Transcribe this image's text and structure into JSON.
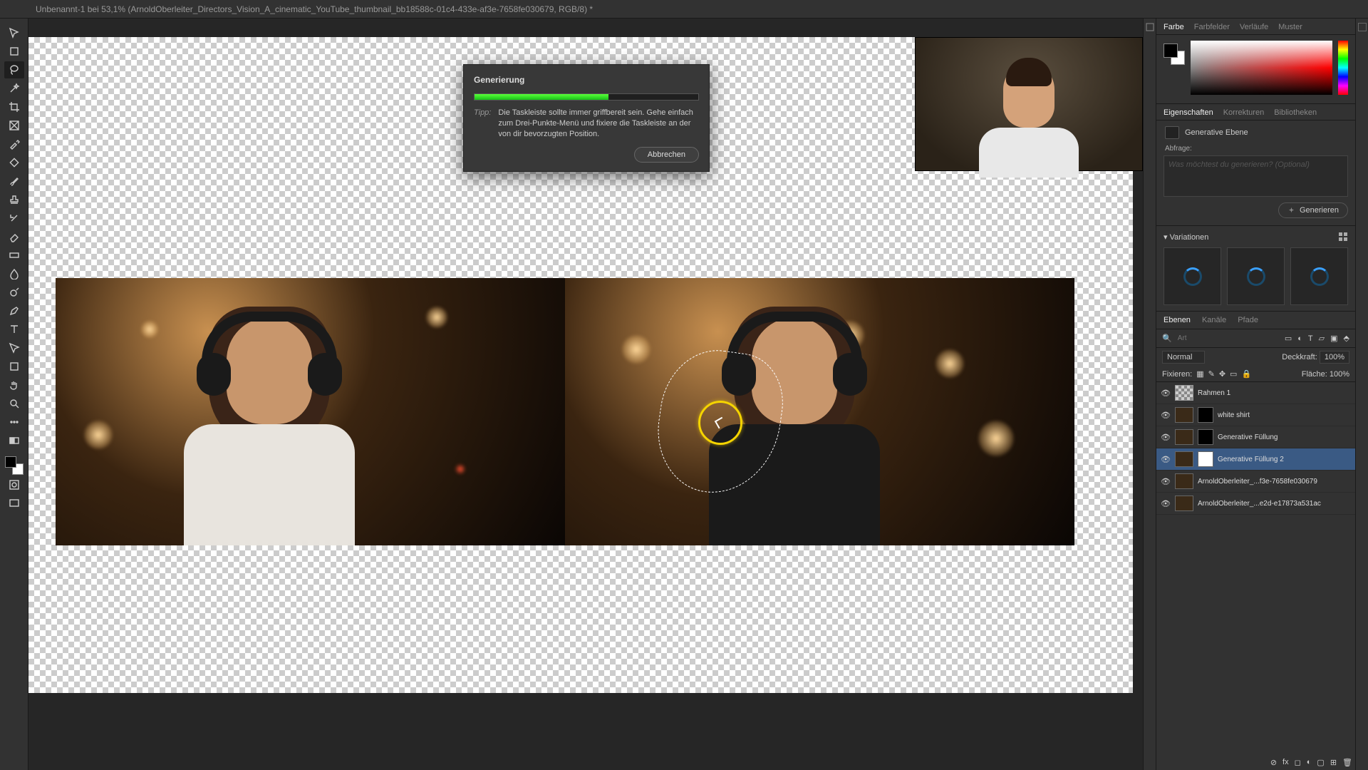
{
  "titlebar": {
    "title": "Unbenannt-1 bei 53,1% (ArnoldOberleiter_Directors_Vision_A_cinematic_YouTube_thumbnail_bb18588c-01c4-433e-af3e-7658fe030679, RGB/8) *"
  },
  "dialog": {
    "title": "Generierung",
    "progress_pct": 60,
    "tip_label": "Tipp:",
    "tip_text": "Die Taskleiste sollte immer griffbereit sein. Gehe einfach zum Drei-Punkte-Menü und fixiere die Taskleiste an der von dir bevorzugten Position.",
    "cancel": "Abbrechen"
  },
  "color_tabs": [
    "Farbe",
    "Farbfelder",
    "Verläufe",
    "Muster"
  ],
  "props_tabs": [
    "Eigenschaften",
    "Korrekturen",
    "Bibliotheken"
  ],
  "props": {
    "layer_type": "Generative Ebene",
    "prompt_label": "Abfrage:",
    "prompt_placeholder": "Was möchtest du generieren? (Optional)",
    "generate": "Generieren"
  },
  "variations": {
    "label": "Variationen"
  },
  "layer_tabs": [
    "Ebenen",
    "Kanäle",
    "Pfade"
  ],
  "layer_opts": {
    "search_placeholder": "Art",
    "blend": "Normal",
    "opacity_label": "Deckkraft:",
    "opacity": "100%",
    "lock_label": "Fixieren:",
    "fill_label": "Fläche:",
    "fill": "100%"
  },
  "layers": [
    {
      "name": "Rahmen 1",
      "frame": true
    },
    {
      "name": "white shirt",
      "mask": "black"
    },
    {
      "name": "Generative Füllung",
      "mask": "black"
    },
    {
      "name": "Generative Füllung 2",
      "mask": "white",
      "selected": true
    },
    {
      "name": "ArnoldOberleiter_...f3e-7658fe030679"
    },
    {
      "name": "ArnoldOberleiter_...e2d-e17873a531ac"
    }
  ],
  "tools": [
    "move",
    "artboard",
    "lasso",
    "wand",
    "crop",
    "frame",
    "eyedrop",
    "heal",
    "brush",
    "stamp",
    "history",
    "eraser",
    "gradient",
    "blur",
    "dodge",
    "pen",
    "type",
    "path",
    "rect",
    "hand",
    "zoom",
    "ellipsis",
    "mode",
    "quick"
  ]
}
